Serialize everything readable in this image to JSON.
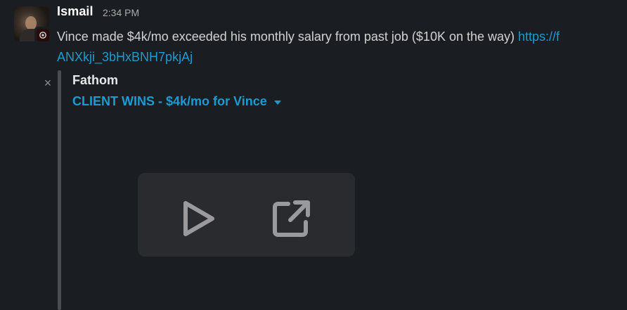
{
  "message": {
    "username": "Ismail",
    "timestamp": "2:34 PM",
    "text": "Vince made $4k/mo exceeded his monthly salary from past job ($10K on the way) ",
    "link_part1": "https://f",
    "link_part2": "ANXkji_3bHxBNH7pkjAj"
  },
  "attachment": {
    "close_glyph": "×",
    "source": "Fathom",
    "title": "CLIENT WINS - $4k/mo for Vince"
  },
  "icons": {
    "play": "play-icon",
    "external_link": "external-link-icon",
    "close": "close-icon",
    "caret": "caret-down-icon"
  },
  "colors": {
    "background": "#1a1d21",
    "link": "#1d9bd1",
    "text": "#d1d2d3",
    "muted": "#ababad",
    "controls_bg": "#2a2b2e"
  }
}
